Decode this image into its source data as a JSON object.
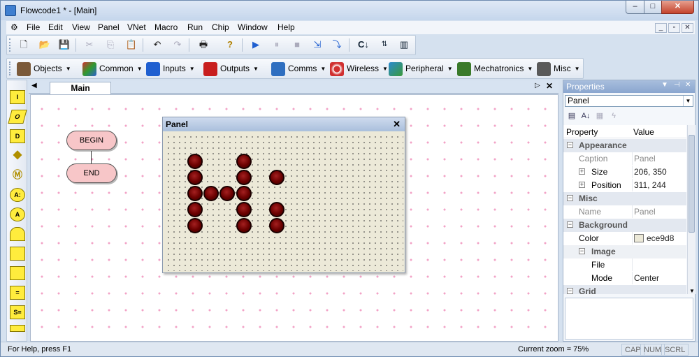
{
  "window": {
    "title": "Flowcode1 * - [Main]",
    "min": "–",
    "max": "□",
    "close": "✕"
  },
  "menu": {
    "items": [
      "File",
      "Edit",
      "View",
      "Panel",
      "VNet",
      "Macro",
      "Run",
      "Chip",
      "Window",
      "Help"
    ],
    "mdi": [
      "_",
      "▫",
      "✕"
    ]
  },
  "toolbar_std": {
    "icons": [
      "new-file-icon",
      "open-folder-icon",
      "save-icon",
      "cut-icon",
      "copy-icon",
      "paste-icon",
      "undo-icon",
      "redo-icon",
      "print-icon",
      "help-icon",
      "run-icon",
      "pause-icon",
      "stop-icon",
      "step-into-icon",
      "step-over-icon",
      "compile-c-icon",
      "compile-hex-icon",
      "compile-chip-icon"
    ]
  },
  "components": {
    "groups": [
      {
        "label": "Objects",
        "icon": "objects-icon",
        "color": "#7b5a3a"
      },
      {
        "label": "Common",
        "icon": "common-icon",
        "color": "#c83232"
      },
      {
        "label": "Inputs",
        "icon": "inputs-icon",
        "color": "#1f5fd0"
      },
      {
        "label": "Outputs",
        "icon": "outputs-icon",
        "color": "#c81e1e"
      },
      {
        "label": "Comms",
        "icon": "comms-icon",
        "color": "#2f6fc0"
      },
      {
        "label": "Wireless",
        "icon": "wireless-icon",
        "color": "#d03030"
      },
      {
        "label": "Peripheral",
        "icon": "peripheral-icon",
        "color": "#2a8ad0"
      },
      {
        "label": "Mechatronics",
        "icon": "mechatronics-icon",
        "color": "#3a7a2a"
      },
      {
        "label": "Misc",
        "icon": "misc-icon",
        "color": "#5a5a5a"
      }
    ]
  },
  "symbols": {
    "labels": [
      "I",
      "O",
      "D",
      "",
      "Ⓜ",
      "A:",
      "A",
      "",
      "",
      "",
      "=",
      "S=",
      ""
    ]
  },
  "tabs": {
    "main_label": "Main",
    "nav_left": "◀",
    "nav_right": "▷",
    "close": "✕"
  },
  "flowchart": {
    "begin": "BEGIN",
    "end": "END"
  },
  "panel_window": {
    "title": "Panel",
    "close": "✕"
  },
  "properties": {
    "title": "Properties",
    "selected_object": "Panel",
    "col_property": "Property",
    "col_value": "Value",
    "rows": [
      {
        "type": "cat",
        "label": "Appearance",
        "toggle": "−"
      },
      {
        "type": "attr",
        "label": "Caption",
        "value": "Panel"
      },
      {
        "type": "prop",
        "label": "Size",
        "value": "206, 350",
        "toggle": "+"
      },
      {
        "type": "prop",
        "label": "Position",
        "value": "311, 244",
        "toggle": "+"
      },
      {
        "type": "cat",
        "label": "Misc",
        "toggle": "−"
      },
      {
        "type": "attr",
        "label": "Name",
        "value": "Panel"
      },
      {
        "type": "cat",
        "label": "Background",
        "toggle": "−"
      },
      {
        "type": "prop",
        "label": "Color",
        "value": "ece9d8",
        "swatch": "#ece9d8"
      },
      {
        "type": "sub",
        "label": "Image",
        "toggle": "−"
      },
      {
        "type": "prop",
        "label": "File",
        "value": ""
      },
      {
        "type": "prop",
        "label": "Mode",
        "value": "Center"
      },
      {
        "type": "cat",
        "label": "Grid",
        "toggle": "−"
      }
    ]
  },
  "status": {
    "help": "For Help, press F1",
    "zoom": "Current zoom = 75%",
    "cap": "CAP",
    "num": "NUM",
    "scrl": "SCRL"
  }
}
